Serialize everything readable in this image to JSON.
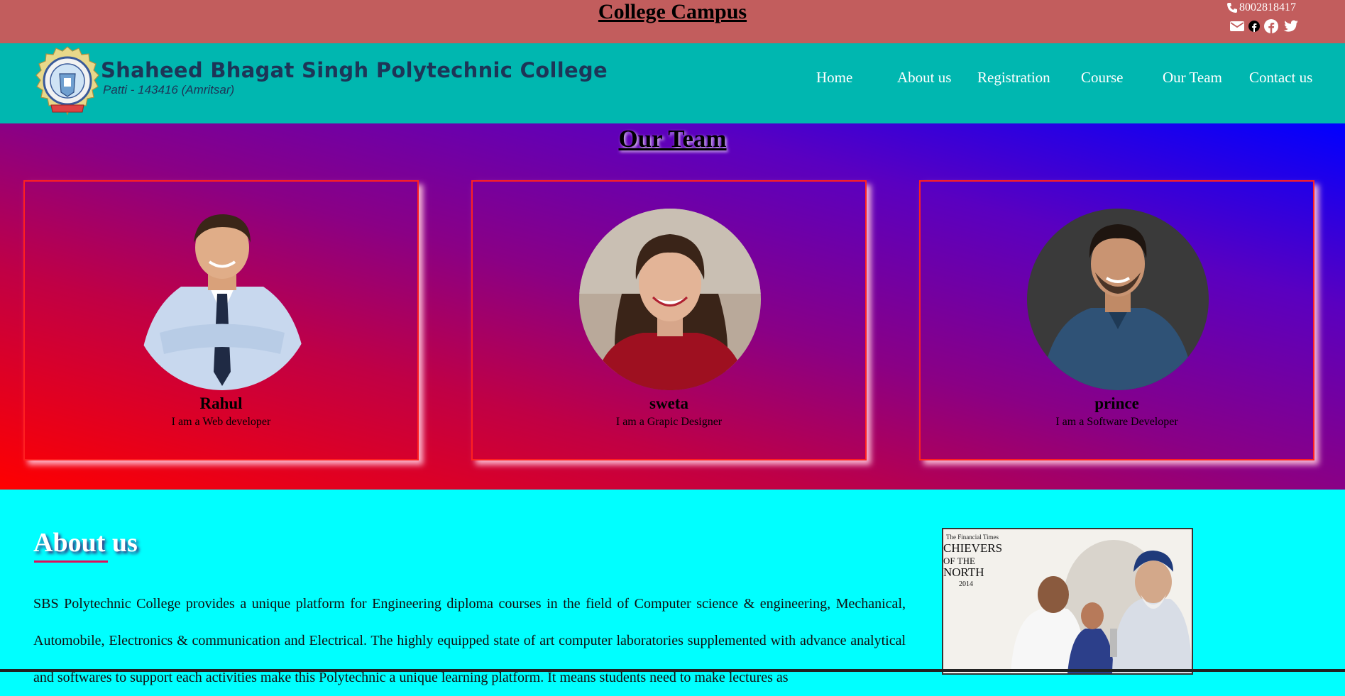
{
  "topbar": {
    "title": "College Campus",
    "phone": "8002818417",
    "icons": [
      "phone-icon",
      "mail-icon",
      "facebook-small-icon",
      "facebook-icon",
      "twitter-icon"
    ]
  },
  "logo": {
    "name": "Shaheed Bhagat Singh Polytechnic College",
    "subtitle": "Patti - 143416 (Amritsar)"
  },
  "nav": {
    "items": [
      "Home",
      "About us",
      "Registration",
      "Course",
      "Our Team",
      "Contact us"
    ]
  },
  "team": {
    "heading": "Our Team",
    "members": [
      {
        "name": "Rahul",
        "role": "I am a Web developer"
      },
      {
        "name": "sweta",
        "role": "I am a Grapic Designer"
      },
      {
        "name": "prince",
        "role": "I am a Software Developer"
      }
    ]
  },
  "about": {
    "heading": "About us",
    "text": "SBS Polytechnic College provides a unique platform for Engineering diploma courses in the field of Computer science & engineering, Mechanical, Automobile, Electronics & communication and Electrical. The highly equipped state of art computer laboratories supplemented with advance analytical and softwares to support each activities make this Polytechnic a unique learning platform. It means students need to make lectures as",
    "photo_caption": [
      "The Financial Times",
      "CHIEVERS",
      "OF THE",
      "NORTH",
      "2014"
    ]
  },
  "colors": {
    "topbar": "#c25d5d",
    "navbar": "#00b7b0",
    "about_bg": "#00ffff"
  }
}
